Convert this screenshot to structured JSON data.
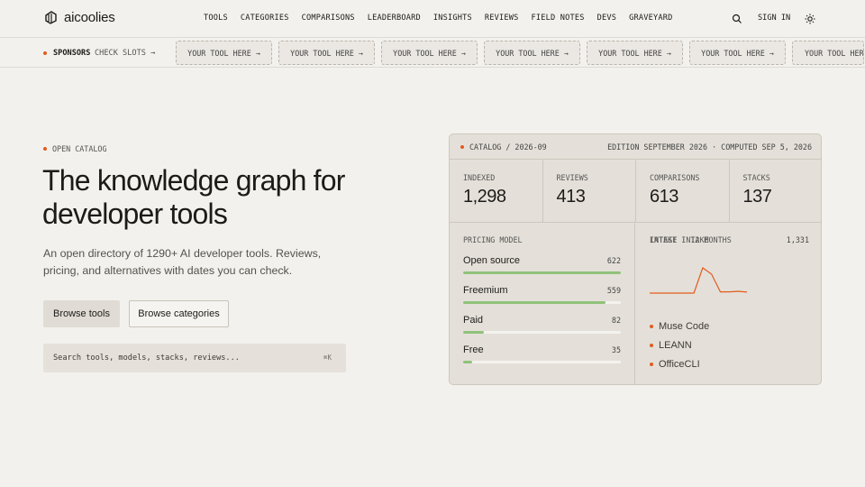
{
  "brand": {
    "name": "aicoolies"
  },
  "nav": {
    "items": [
      "TOOLS",
      "CATEGORIES",
      "COMPARISONS",
      "LEADERBOARD",
      "INSIGHTS",
      "REVIEWS",
      "FIELD NOTES",
      "DEVS",
      "GRAVEYARD"
    ],
    "sign_in": "SIGN IN",
    "icons": {
      "search": "search-icon",
      "theme": "sun-icon"
    }
  },
  "sponsors": {
    "label": "SPONSORS",
    "check_slots": "CHECK SLOTS →",
    "slots": [
      "YOUR TOOL HERE →",
      "YOUR TOOL HERE →",
      "YOUR TOOL HERE →",
      "YOUR TOOL HERE →",
      "YOUR TOOL HERE →",
      "YOUR TOOL HERE →",
      "YOUR TOOL HERE →"
    ]
  },
  "hero": {
    "eyebrow": "OPEN CATALOG",
    "title": "The knowledge graph for developer tools",
    "subtitle": "An open directory of 1290+ AI developer tools. Reviews, pricing, and alternatives with dates you can check.",
    "browse_tools": "Browse tools",
    "browse_categories": "Browse categories",
    "search_placeholder": "Search tools, models, stacks, reviews...",
    "search_shortcut": "⌘K"
  },
  "panel": {
    "catalog": "CATALOG / 2026-09",
    "edition": "EDITION SEPTEMBER 2026 · COMPUTED SEP 5, 2026",
    "stats": [
      {
        "label": "INDEXED",
        "value": "1,298"
      },
      {
        "label": "REVIEWS",
        "value": "413"
      },
      {
        "label": "COMPARISONS",
        "value": "613"
      },
      {
        "label": "STACKS",
        "value": "137"
      }
    ],
    "pricing": {
      "label": "PRICING MODEL",
      "rows": [
        {
          "name": "Open source",
          "count": "622",
          "fraction": 1.0
        },
        {
          "name": "Freemium",
          "count": "559",
          "fraction": 0.9
        },
        {
          "name": "Paid",
          "count": "82",
          "fraction": 0.13
        },
        {
          "name": "Free",
          "count": "35",
          "fraction": 0.056
        }
      ]
    },
    "intake": {
      "label": "INTAKE · 12 MONTHS",
      "total": "1,331",
      "sparkline": [
        0,
        0,
        0,
        0,
        0,
        0,
        1,
        0.75,
        0.05,
        0.05,
        0.07,
        0.04
      ],
      "latest_label": "LATEST INTAKE",
      "latest": [
        "Muse Code",
        "LEANN",
        "OfficeCLI"
      ],
      "accent": "#e35b1e"
    }
  },
  "colors": {
    "accent": "#e35b1e",
    "bar": "#8fc27a",
    "background": "#f3f1ed",
    "panel": "#e4e0d9"
  }
}
